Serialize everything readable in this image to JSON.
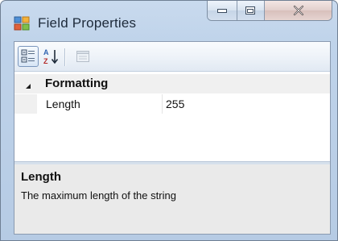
{
  "window": {
    "title": "Field Properties",
    "app_icon": "field-properties-app-icon",
    "caption_buttons": {
      "minimize_icon": "minimize-icon",
      "maximize_icon": "maximize-icon",
      "close_icon": "close-icon"
    }
  },
  "toolbar": {
    "buttons": [
      {
        "name": "categorized-icon",
        "pressed": true
      },
      {
        "name": "sort-alphabetical-icon",
        "pressed": false
      },
      {
        "name": "property-pages-icon",
        "pressed": false,
        "enabled": false
      }
    ]
  },
  "grid": {
    "category": {
      "label": "Formatting",
      "expanded": true
    },
    "properties": [
      {
        "name": "Length",
        "value": "255"
      }
    ]
  },
  "help": {
    "title": "Length",
    "description": "The maximum length of the string"
  },
  "colors": {
    "titlebar": "#c2d5eb",
    "category_background": "#f0f0f0",
    "help_background": "#eaeaea",
    "border": "#8a9ab0"
  }
}
